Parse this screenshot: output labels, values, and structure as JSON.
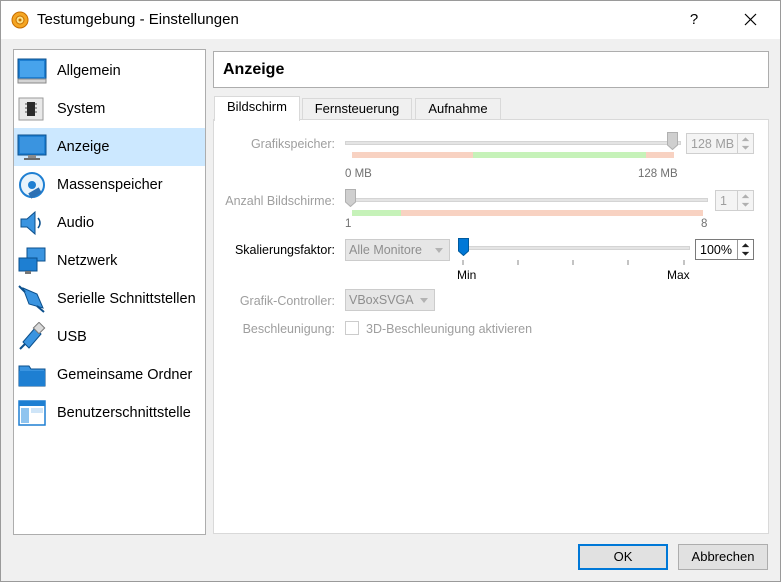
{
  "window": {
    "title": "Testumgebung - Einstellungen",
    "help_label": "?"
  },
  "sidebar": {
    "items": [
      {
        "label": "Allgemein",
        "icon": "general-icon"
      },
      {
        "label": "System",
        "icon": "system-icon"
      },
      {
        "label": "Anzeige",
        "icon": "display-icon",
        "selected": true
      },
      {
        "label": "Massenspeicher",
        "icon": "storage-icon"
      },
      {
        "label": "Audio",
        "icon": "audio-icon"
      },
      {
        "label": "Netzwerk",
        "icon": "network-icon"
      },
      {
        "label": "Serielle Schnittstellen",
        "icon": "serial-port-icon"
      },
      {
        "label": "USB",
        "icon": "usb-icon"
      },
      {
        "label": "Gemeinsame Ordner",
        "icon": "shared-folder-icon"
      },
      {
        "label": "Benutzerschnittstelle",
        "icon": "user-interface-icon"
      }
    ]
  },
  "header": {
    "title": "Anzeige"
  },
  "tabs": [
    {
      "label": "Bildschirm",
      "active": true
    },
    {
      "label": "Fernsteuerung",
      "active": false
    },
    {
      "label": "Aufnahme",
      "active": false
    }
  ],
  "screen": {
    "video_memory": {
      "label": "Grafikspeicher:",
      "value_text": "128 MB",
      "min_label": "0 MB",
      "max_label": "128 MB",
      "level": 1.0,
      "enabled": false
    },
    "monitor_count": {
      "label": "Anzahl Bildschirme:",
      "value_text": "1",
      "min_label": "1",
      "max_label": "8",
      "level": 0.0,
      "enabled": false
    },
    "scale_factor": {
      "label": "Skalierungsfaktor:",
      "monitor_select": "Alle Monitore",
      "value_text": "100%",
      "min_label": "Min",
      "max_label": "Max",
      "level": 0.0,
      "enabled": true
    },
    "graphics_controller": {
      "label": "Grafik-Controller:",
      "value": "VBoxSVGA",
      "enabled": false
    },
    "acceleration": {
      "label": "Beschleunigung:",
      "checkbox_label": "3D-Beschleunigung aktivieren",
      "checked": false,
      "enabled": false
    }
  },
  "footer": {
    "ok_label": "OK",
    "cancel_label": "Abbrechen"
  },
  "colors": {
    "selection": "#cce8ff",
    "zone_green": "#c6f2b9",
    "zone_red": "#f8d2c2",
    "accent_blue": "#0078d7"
  }
}
